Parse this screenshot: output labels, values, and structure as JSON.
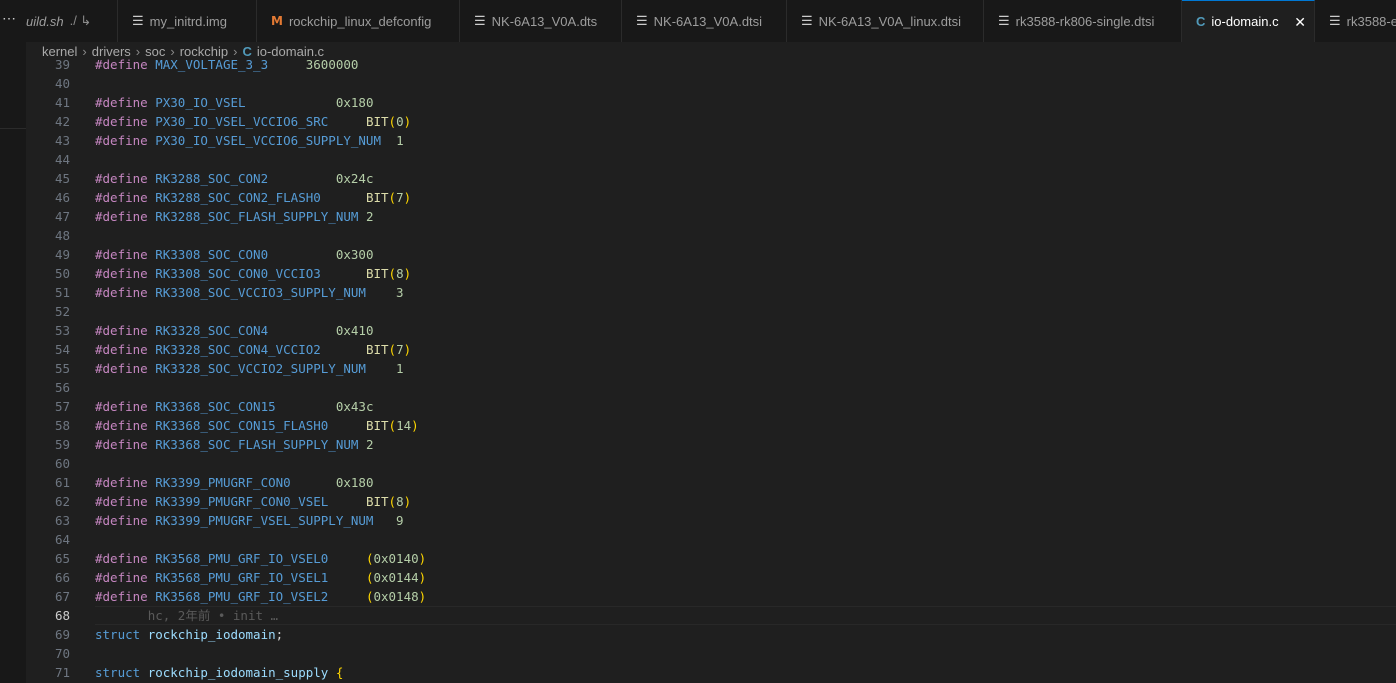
{
  "tabs": [
    {
      "label": "uild.sh",
      "suffix": "./ ↳",
      "icon": "file-lines-icon"
    },
    {
      "label": "my_initrd.img",
      "icon": "file-lines-icon"
    },
    {
      "label": "rockchip_linux_defconfig",
      "icon": "makefile-m-icon"
    },
    {
      "label": "NK-6A13_V0A.dts",
      "icon": "file-lines-icon"
    },
    {
      "label": "NK-6A13_V0A.dtsi",
      "icon": "file-lines-icon"
    },
    {
      "label": "NK-6A13_V0A_linux.dtsi",
      "icon": "file-lines-icon"
    },
    {
      "label": "rk3588-rk806-single.dtsi",
      "icon": "file-lines-icon"
    },
    {
      "label": "io-domain.c",
      "icon": "c-file-icon",
      "active": true
    },
    {
      "label": "rk3588-e",
      "icon": "file-lines-icon"
    }
  ],
  "sidebar": {
    "more_label": "⋯"
  },
  "breadcrumb": [
    "kernel",
    "drivers",
    "soc",
    "rockchip",
    "io-domain.c"
  ],
  "editor": {
    "current_line": 68,
    "blame": "hc, 2年前 • init …",
    "lines": [
      {
        "n": 39,
        "kind": "define",
        "name": "MAX_VOLTAGE_3_3",
        "pad": "     ",
        "value": "3600000"
      },
      {
        "n": 40,
        "kind": "blank"
      },
      {
        "n": 41,
        "kind": "define",
        "name": "PX30_IO_VSEL",
        "pad": "            ",
        "value": "0x180"
      },
      {
        "n": 42,
        "kind": "define_bit",
        "name": "PX30_IO_VSEL_VCCIO6_SRC",
        "pad": "     ",
        "value": "0"
      },
      {
        "n": 43,
        "kind": "define",
        "name": "PX30_IO_VSEL_VCCIO6_SUPPLY_NUM",
        "pad": "  ",
        "value": "1"
      },
      {
        "n": 44,
        "kind": "blank"
      },
      {
        "n": 45,
        "kind": "define",
        "name": "RK3288_SOC_CON2",
        "pad": "         ",
        "value": "0x24c"
      },
      {
        "n": 46,
        "kind": "define_bit",
        "name": "RK3288_SOC_CON2_FLASH0",
        "pad": "      ",
        "value": "7"
      },
      {
        "n": 47,
        "kind": "define",
        "name": "RK3288_SOC_FLASH_SUPPLY_NUM",
        "pad": " ",
        "value": "2"
      },
      {
        "n": 48,
        "kind": "blank"
      },
      {
        "n": 49,
        "kind": "define",
        "name": "RK3308_SOC_CON0",
        "pad": "         ",
        "value": "0x300"
      },
      {
        "n": 50,
        "kind": "define_bit",
        "name": "RK3308_SOC_CON0_VCCIO3",
        "pad": "      ",
        "value": "8"
      },
      {
        "n": 51,
        "kind": "define",
        "name": "RK3308_SOC_VCCIO3_SUPPLY_NUM",
        "pad": "    ",
        "value": "3"
      },
      {
        "n": 52,
        "kind": "blank"
      },
      {
        "n": 53,
        "kind": "define",
        "name": "RK3328_SOC_CON4",
        "pad": "         ",
        "value": "0x410"
      },
      {
        "n": 54,
        "kind": "define_bit",
        "name": "RK3328_SOC_CON4_VCCIO2",
        "pad": "      ",
        "value": "7"
      },
      {
        "n": 55,
        "kind": "define",
        "name": "RK3328_SOC_VCCIO2_SUPPLY_NUM",
        "pad": "    ",
        "value": "1"
      },
      {
        "n": 56,
        "kind": "blank"
      },
      {
        "n": 57,
        "kind": "define",
        "name": "RK3368_SOC_CON15",
        "pad": "        ",
        "value": "0x43c"
      },
      {
        "n": 58,
        "kind": "define_bit",
        "name": "RK3368_SOC_CON15_FLASH0",
        "pad": "     ",
        "value": "14"
      },
      {
        "n": 59,
        "kind": "define",
        "name": "RK3368_SOC_FLASH_SUPPLY_NUM",
        "pad": " ",
        "value": "2"
      },
      {
        "n": 60,
        "kind": "blank"
      },
      {
        "n": 61,
        "kind": "define",
        "name": "RK3399_PMUGRF_CON0",
        "pad": "      ",
        "value": "0x180"
      },
      {
        "n": 62,
        "kind": "define_bit",
        "name": "RK3399_PMUGRF_CON0_VSEL",
        "pad": "     ",
        "value": "8"
      },
      {
        "n": 63,
        "kind": "define",
        "name": "RK3399_PMUGRF_VSEL_SUPPLY_NUM",
        "pad": "   ",
        "value": "9"
      },
      {
        "n": 64,
        "kind": "blank"
      },
      {
        "n": 65,
        "kind": "define_paren",
        "name": "RK3568_PMU_GRF_IO_VSEL0",
        "pad": "     ",
        "value": "0x0140"
      },
      {
        "n": 66,
        "kind": "define_paren",
        "name": "RK3568_PMU_GRF_IO_VSEL1",
        "pad": "     ",
        "value": "0x0144"
      },
      {
        "n": 67,
        "kind": "define_paren",
        "name": "RK3568_PMU_GRF_IO_VSEL2",
        "pad": "     ",
        "value": "0x0148"
      },
      {
        "n": 68,
        "kind": "blame"
      },
      {
        "n": 69,
        "kind": "struct_decl",
        "keyword": "struct",
        "name": "rockchip_iodomain",
        "tail": ";"
      },
      {
        "n": 70,
        "kind": "blank"
      },
      {
        "n": 71,
        "kind": "struct_decl",
        "keyword": "struct",
        "name": "rockchip_iodomain_supply",
        "tail": " {"
      }
    ],
    "tokens": {
      "define": "#define",
      "bit": "BIT"
    }
  }
}
